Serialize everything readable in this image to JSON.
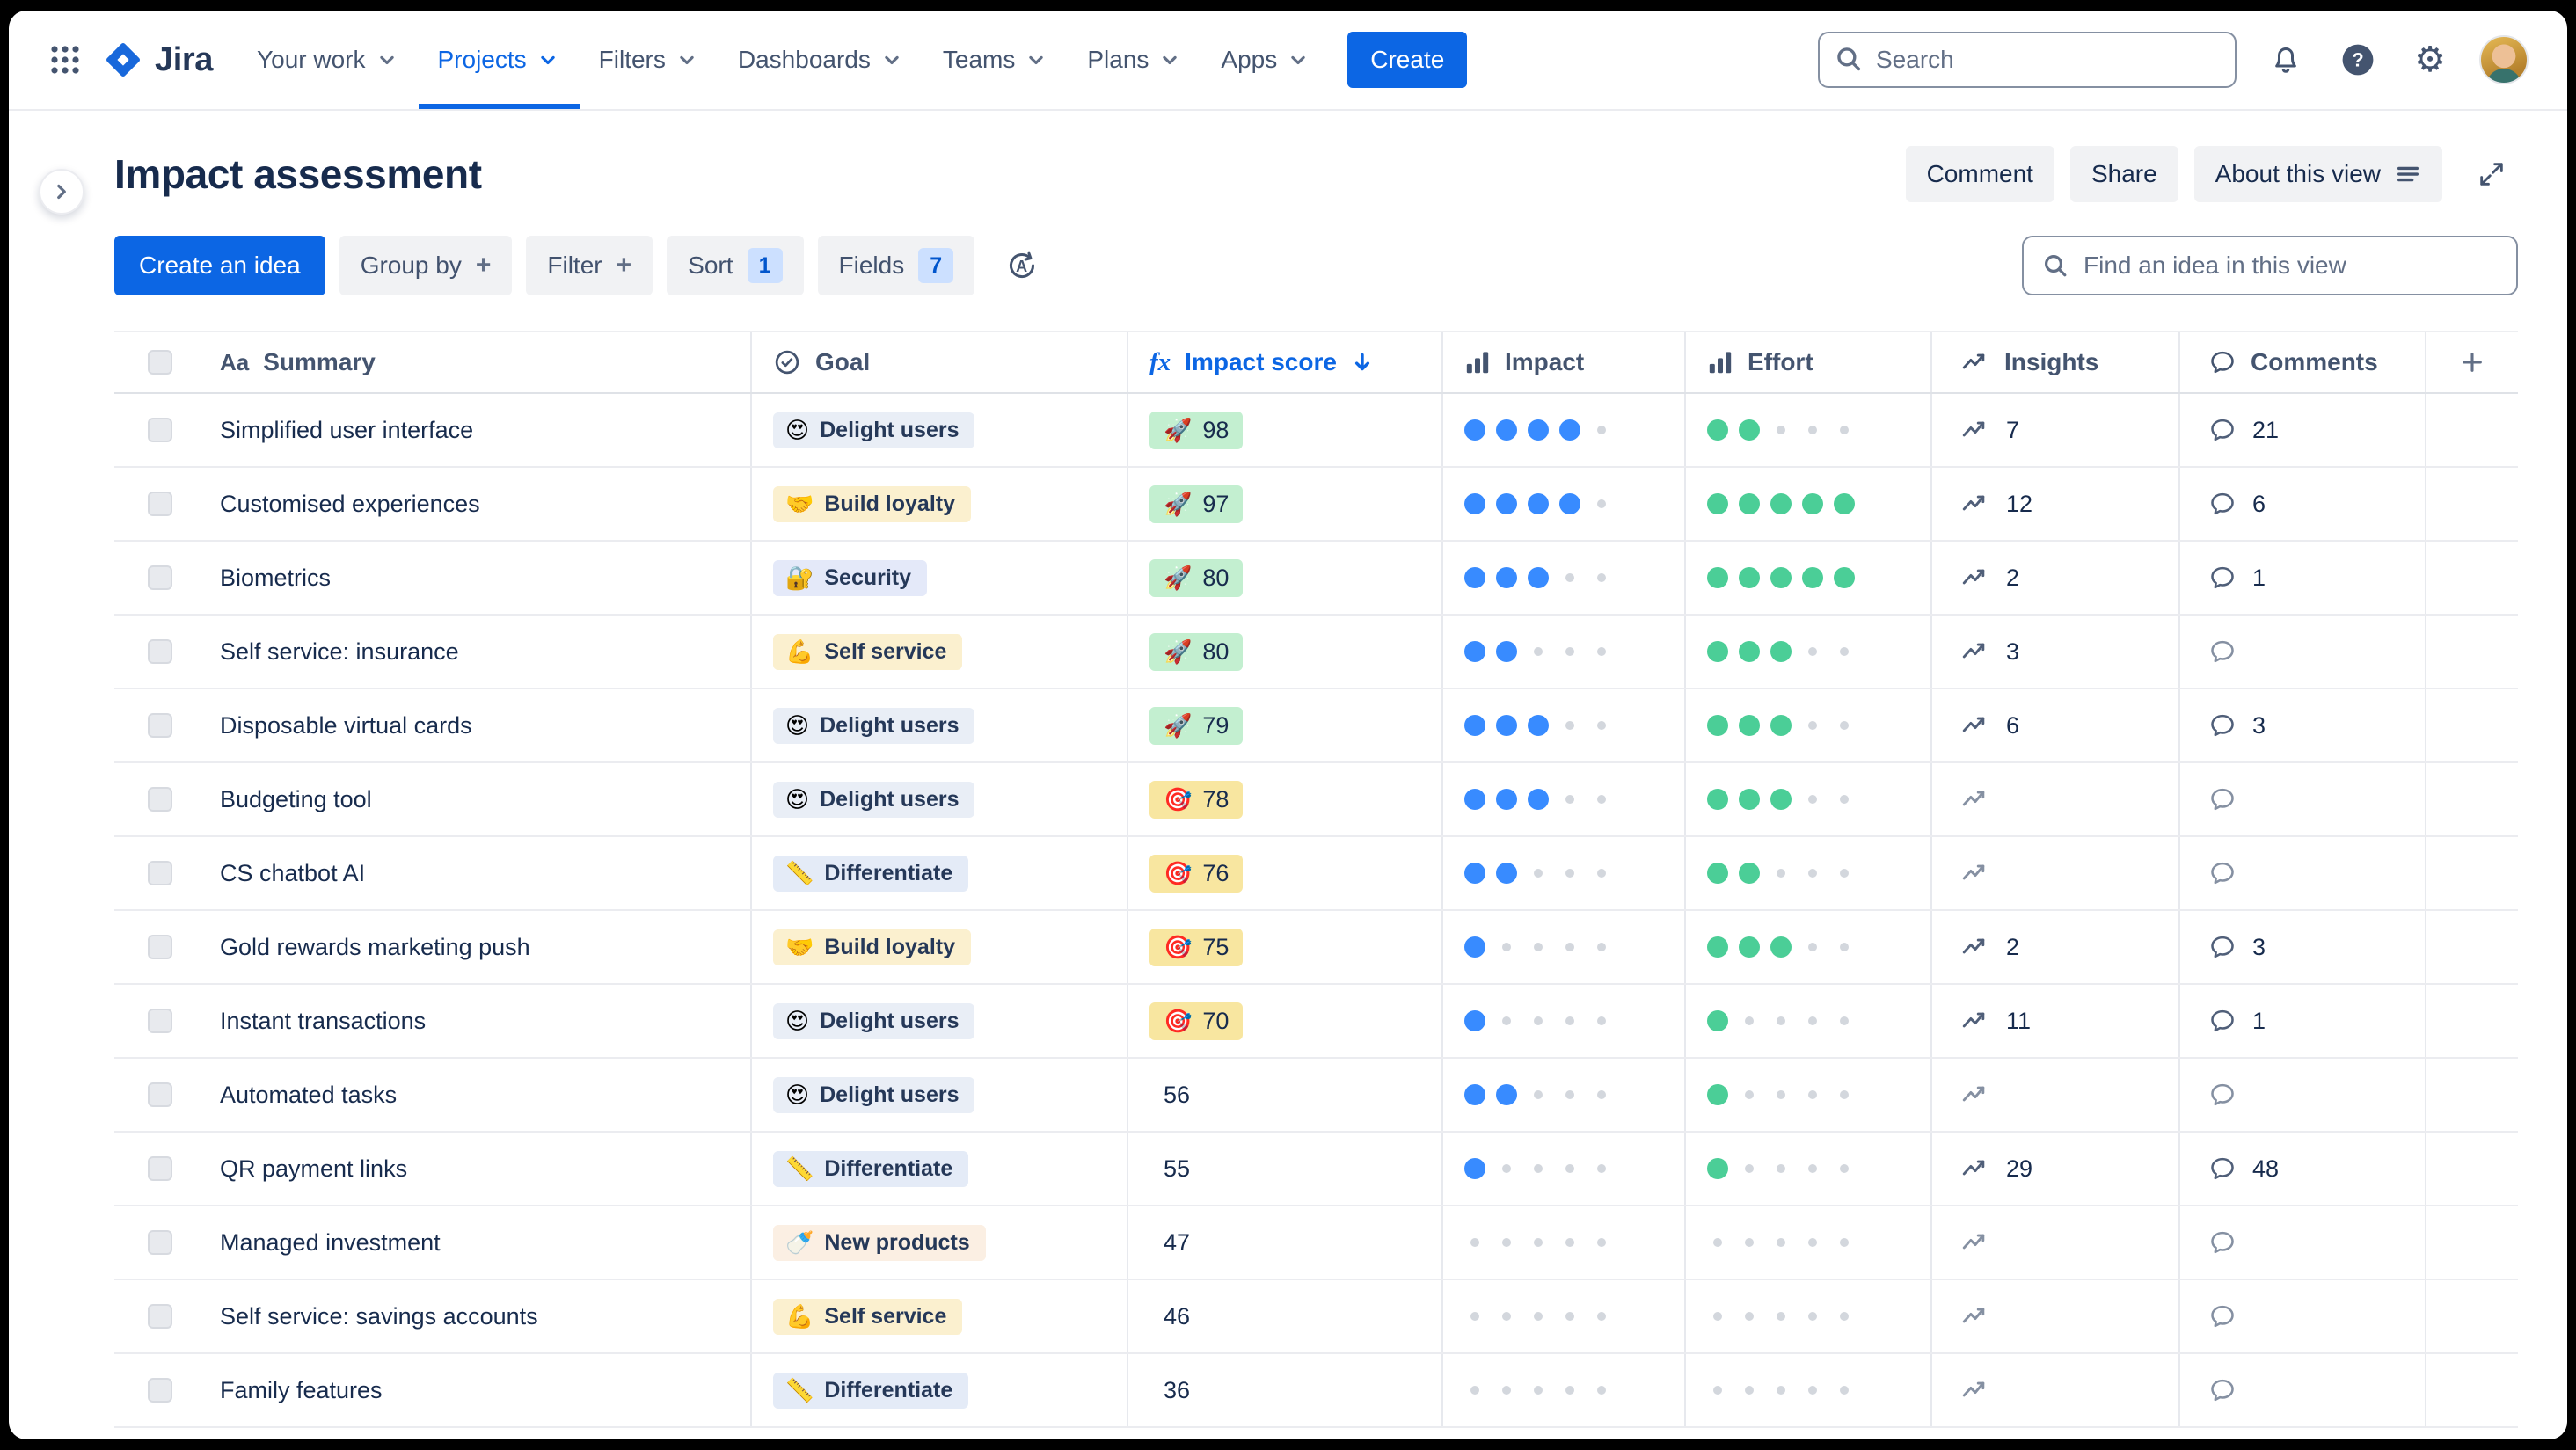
{
  "nav": {
    "logo": "Jira",
    "items": [
      "Your work",
      "Projects",
      "Filters",
      "Dashboards",
      "Teams",
      "Plans",
      "Apps"
    ],
    "active_item": "Projects",
    "create": "Create",
    "search_placeholder": "Search"
  },
  "header": {
    "title": "Impact assessment",
    "comment": "Comment",
    "share": "Share",
    "about": "About this view"
  },
  "toolbar": {
    "create_idea": "Create an idea",
    "group_by": "Group by",
    "filter": "Filter",
    "sort": "Sort",
    "sort_count": "1",
    "fields": "Fields",
    "fields_count": "7",
    "find_placeholder": "Find an idea in this view"
  },
  "columns": {
    "summary": "Summary",
    "goal": "Goal",
    "impact_score": "Impact score",
    "impact": "Impact",
    "effort": "Effort",
    "insights": "Insights",
    "comments": "Comments"
  },
  "goals": {
    "Delight users": {
      "emoji": "😍",
      "bg": "#E9EEF6"
    },
    "Build loyalty": {
      "emoji": "🤝",
      "bg": "#FBF0CF"
    },
    "Security": {
      "emoji": "🔐",
      "bg": "#E4E9F9"
    },
    "Self service": {
      "emoji": "💪",
      "bg": "#FBF0CF"
    },
    "Differentiate": {
      "emoji": "📏",
      "bg": "#E4EBF7"
    },
    "New products": {
      "emoji": "🍼",
      "bg": "#FBEFE3"
    }
  },
  "colors": {
    "accent_blue": "#0C66E4",
    "impact_dot": "#388BFF",
    "effort_dot": "#4BCE97",
    "empty_dot": "#D3D7DD",
    "score_green_bg": "#C3EFD0",
    "score_yellow_bg": "#F8E6A0",
    "count_badge_bg": "#CCE0FF",
    "count_badge_text": "#0055CC"
  },
  "table": {
    "dot_scale_max": 5,
    "rows": [
      {
        "summary": "Simplified user interface",
        "goal": "Delight users",
        "score": 98,
        "score_badge": "green",
        "score_emoji": "🚀",
        "impact": 4,
        "effort": 2,
        "insights": 7,
        "comments": 21
      },
      {
        "summary": "Customised experiences",
        "goal": "Build loyalty",
        "score": 97,
        "score_badge": "green",
        "score_emoji": "🚀",
        "impact": 4,
        "effort": 5,
        "insights": 12,
        "comments": 6
      },
      {
        "summary": "Biometrics",
        "goal": "Security",
        "score": 80,
        "score_badge": "green",
        "score_emoji": "🚀",
        "impact": 3,
        "effort": 5,
        "insights": 2,
        "comments": 1
      },
      {
        "summary": "Self service: insurance",
        "goal": "Self service",
        "score": 80,
        "score_badge": "green",
        "score_emoji": "🚀",
        "impact": 2,
        "effort": 3,
        "insights": 3,
        "comments": null
      },
      {
        "summary": "Disposable virtual cards",
        "goal": "Delight users",
        "score": 79,
        "score_badge": "green",
        "score_emoji": "🚀",
        "impact": 3,
        "effort": 3,
        "insights": 6,
        "comments": 3
      },
      {
        "summary": "Budgeting tool",
        "goal": "Delight users",
        "score": 78,
        "score_badge": "yellow",
        "score_emoji": "🎯",
        "impact": 3,
        "effort": 3,
        "insights": null,
        "comments": null
      },
      {
        "summary": "CS chatbot AI",
        "goal": "Differentiate",
        "score": 76,
        "score_badge": "yellow",
        "score_emoji": "🎯",
        "impact": 2,
        "effort": 2,
        "insights": null,
        "comments": null
      },
      {
        "summary": "Gold rewards marketing push",
        "goal": "Build loyalty",
        "score": 75,
        "score_badge": "yellow",
        "score_emoji": "🎯",
        "impact": 1,
        "effort": 3,
        "insights": 2,
        "comments": 3
      },
      {
        "summary": "Instant transactions",
        "goal": "Delight users",
        "score": 70,
        "score_badge": "yellow",
        "score_emoji": "🎯",
        "impact": 1,
        "effort": 1,
        "insights": 11,
        "comments": 1
      },
      {
        "summary": "Automated tasks",
        "goal": "Delight users",
        "score": 56,
        "score_badge": "none",
        "score_emoji": null,
        "impact": 2,
        "effort": 1,
        "insights": null,
        "comments": null
      },
      {
        "summary": "QR payment links",
        "goal": "Differentiate",
        "score": 55,
        "score_badge": "none",
        "score_emoji": null,
        "impact": 1,
        "effort": 1,
        "insights": 29,
        "comments": 48
      },
      {
        "summary": "Managed investment",
        "goal": "New products",
        "score": 47,
        "score_badge": "none",
        "score_emoji": null,
        "impact": 0,
        "effort": 0,
        "insights": null,
        "comments": null
      },
      {
        "summary": "Self service: savings accounts",
        "goal": "Self service",
        "score": 46,
        "score_badge": "none",
        "score_emoji": null,
        "impact": 0,
        "effort": 0,
        "insights": null,
        "comments": null
      },
      {
        "summary": "Family features",
        "goal": "Differentiate",
        "score": 36,
        "score_badge": "none",
        "score_emoji": null,
        "impact": 0,
        "effort": 0,
        "insights": null,
        "comments": null
      }
    ]
  }
}
